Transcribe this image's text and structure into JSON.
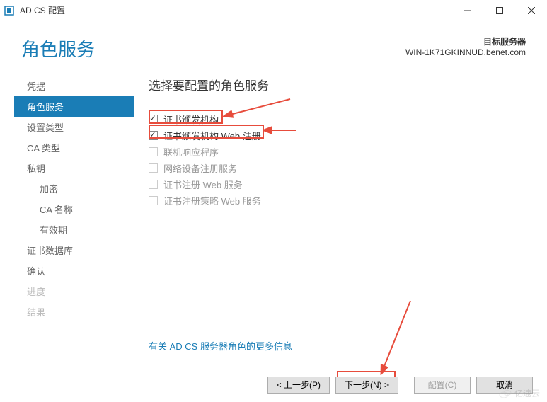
{
  "titlebar": {
    "app_title": "AD CS 配置"
  },
  "header": {
    "title": "角色服务",
    "target_label": "目标服务器",
    "target_server": "WIN-1K71GKINNUD.benet.com"
  },
  "sidebar": {
    "items": [
      {
        "label": "凭据",
        "active": false
      },
      {
        "label": "角色服务",
        "active": true
      },
      {
        "label": "设置类型",
        "active": false
      },
      {
        "label": "CA 类型",
        "active": false
      },
      {
        "label": "私钥",
        "active": false
      },
      {
        "label": "加密",
        "active": false,
        "sub": true
      },
      {
        "label": "CA 名称",
        "active": false,
        "sub": true
      },
      {
        "label": "有效期",
        "active": false,
        "sub": true
      },
      {
        "label": "证书数据库",
        "active": false
      },
      {
        "label": "确认",
        "active": false
      },
      {
        "label": "进度",
        "active": false
      },
      {
        "label": "结果",
        "active": false
      }
    ]
  },
  "main": {
    "heading": "选择要配置的角色服务",
    "options": [
      {
        "label": "证书颁发机构",
        "checked": true
      },
      {
        "label": "证书颁发机构 Web 注册",
        "checked": true
      },
      {
        "label": "联机响应程序",
        "checked": false
      },
      {
        "label": "网络设备注册服务",
        "checked": false
      },
      {
        "label": "证书注册 Web 服务",
        "checked": false
      },
      {
        "label": "证书注册策略 Web 服务",
        "checked": false
      }
    ],
    "more_link": "有关 AD CS 服务器角色的更多信息"
  },
  "footer": {
    "prev": "< 上一步(P)",
    "next": "下一步(N) >",
    "config": "配置(C)",
    "cancel": "取消"
  },
  "watermark": "亿速云"
}
